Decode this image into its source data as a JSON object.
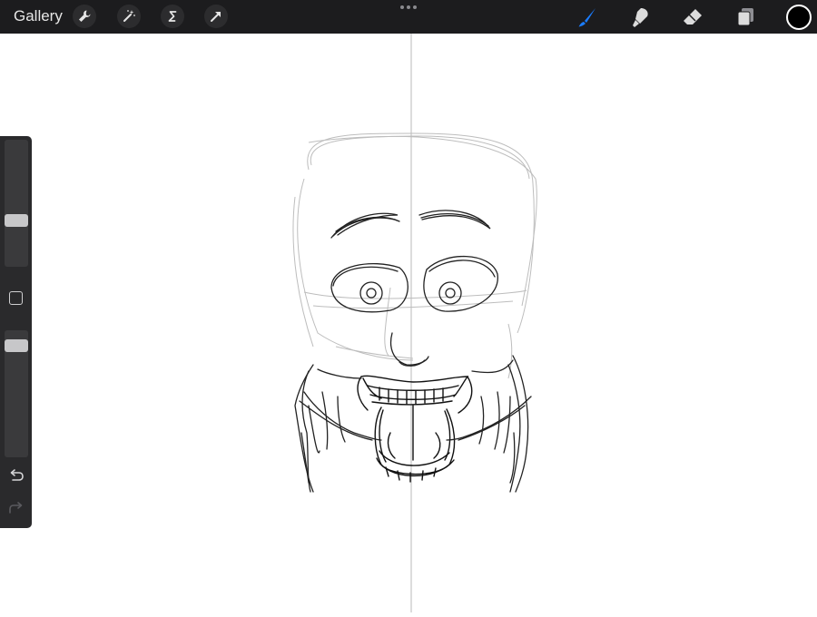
{
  "toolbar": {
    "gallery_label": "Gallery",
    "left_tools": [
      "wrench-icon",
      "magic-wand-icon",
      "selection-s-icon",
      "transform-arrow-icon"
    ],
    "right_tools": [
      "brush-icon",
      "smudge-icon",
      "eraser-icon",
      "layers-icon"
    ],
    "active_tool": "brush-icon",
    "current_color": "#000000"
  },
  "sidebar": {
    "brush_size_level": 0.35,
    "opacity_level": 0.92
  },
  "canvas": {
    "symmetry_guide": "vertical",
    "background": "#ffffff"
  },
  "colors": {
    "toolbar_bg": "#1c1c1e",
    "accent": "#1a7cff"
  }
}
